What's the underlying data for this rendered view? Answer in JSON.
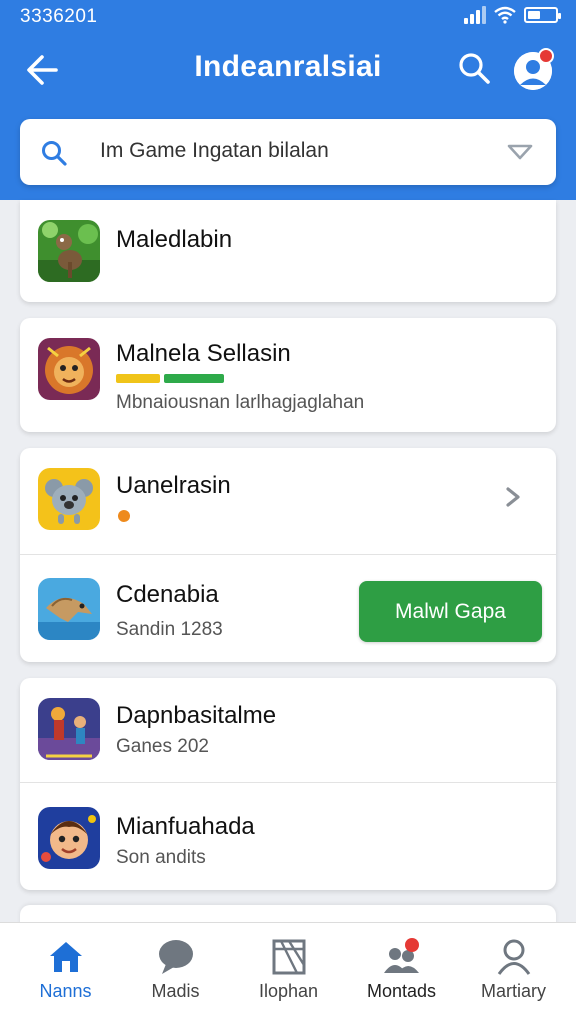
{
  "status": {
    "time": "3336201"
  },
  "header": {
    "title": "Indeanralsiai"
  },
  "search": {
    "text": "Im Game Ingatan bilalan"
  },
  "apps": [
    {
      "name": "Maledlabin",
      "sub": ""
    },
    {
      "name": "Malnela Sellasin",
      "sub": "Mbnaiousnan larlhagjaglahan"
    },
    {
      "name": "Uanelrasin",
      "sub": ""
    },
    {
      "name": "Cdenabia",
      "sub": "Sandin 1283",
      "action": "Malwl Gapa"
    },
    {
      "name": "Dapnbasitalme",
      "sub": "Ganes 202"
    },
    {
      "name": "Mianfuahada",
      "sub": "Son andits"
    }
  ],
  "nav": [
    {
      "label": "Nanns",
      "icon": "home-icon",
      "active": true
    },
    {
      "label": "Madis",
      "icon": "chat-bubble-icon"
    },
    {
      "label": "Ilophan",
      "icon": "book-icon"
    },
    {
      "label": "Montads",
      "icon": "people-icon"
    },
    {
      "label": "Martiary",
      "icon": "person-icon"
    }
  ],
  "colors": {
    "primary": "#2f7de2",
    "action": "#2e9e44",
    "navActive": "#1e6fd6",
    "badge": "#e53935"
  }
}
